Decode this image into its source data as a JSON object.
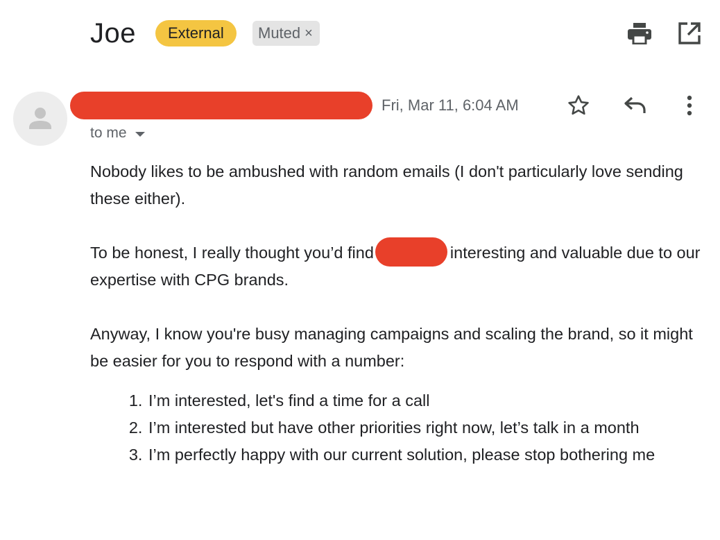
{
  "header": {
    "subject": "Joe",
    "external_label": "External",
    "muted_label": "Muted",
    "muted_close": "×",
    "print_icon": "print-icon",
    "open_new_window_icon": "open-in-new-icon"
  },
  "message": {
    "avatar_icon": "person-icon",
    "date": "Fri, Mar 11, 6:04 AM",
    "recipient_label": "to me",
    "star_icon": "star-outline-icon",
    "reply_icon": "reply-icon",
    "more_icon": "more-vertical-icon",
    "redaction_color": "#e8402a"
  },
  "body": {
    "paragraph1": "Nobody likes to be ambushed with random emails (I don't particularly love sending these either).",
    "paragraph2_before": "To be honest, I really thought you’d find",
    "paragraph2_after": "interesting and valuable due to our expertise with CPG brands.",
    "paragraph3": "Anyway, I know you're busy managing campaigns and scaling the brand, so it might be easier for you to respond with a number:",
    "options": [
      "I’m interested, let's find a time for a call",
      "I’m interested but have other priorities right now, let’s talk in a month",
      "I’m perfectly happy with our current solution, please stop bothering me"
    ]
  }
}
